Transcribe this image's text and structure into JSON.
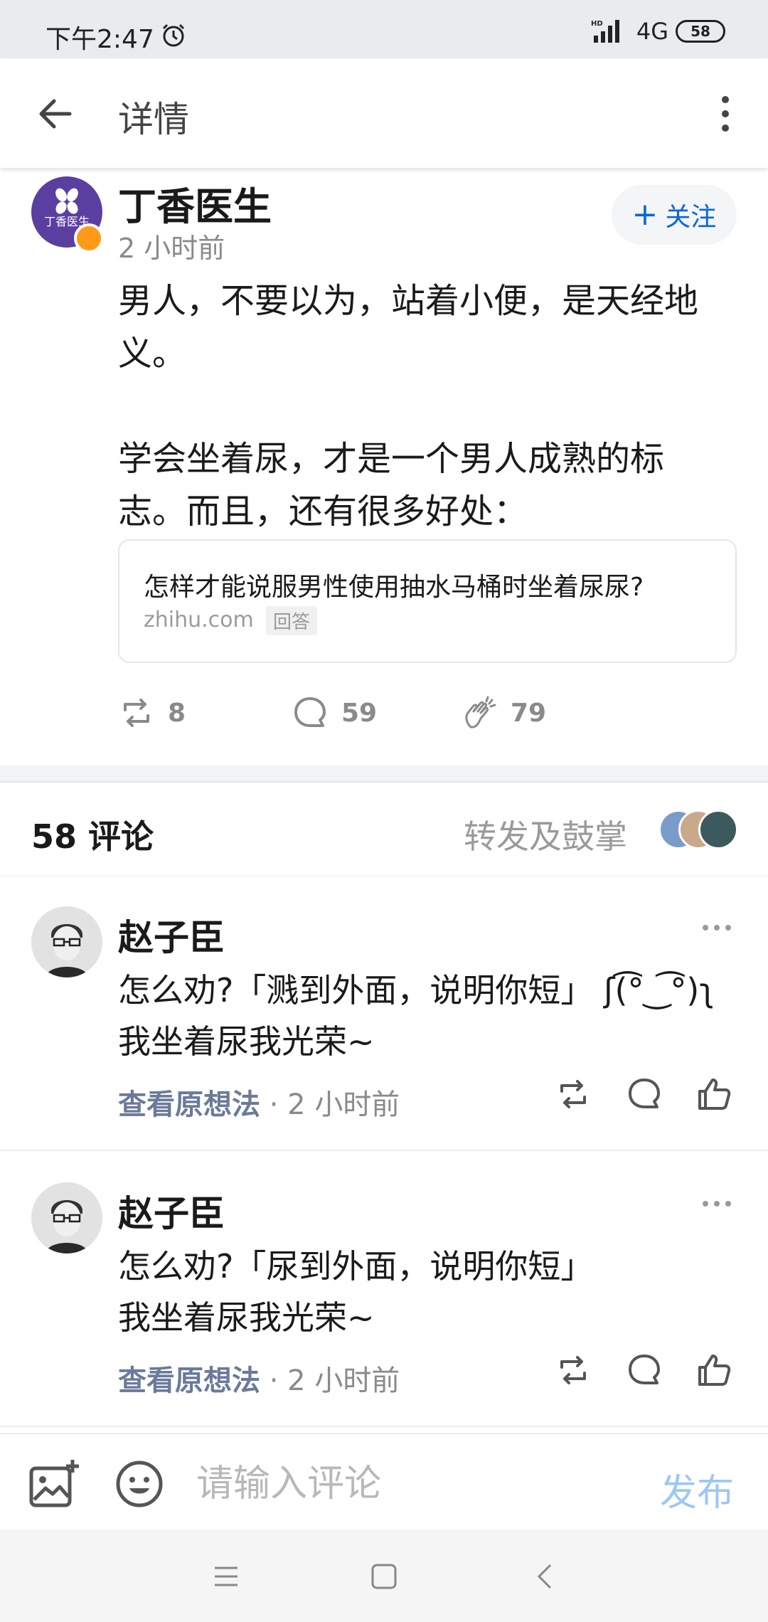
{
  "status_bar": {
    "time": "下午2:47",
    "hd_label": "HD",
    "network": "4G",
    "battery": "58"
  },
  "app_bar": {
    "title": "详情"
  },
  "post": {
    "author": "丁香医生",
    "avatar_text": "丁香医生",
    "time": "2 小时前",
    "follow_label": "关注",
    "paragraphs": [
      "男人，不要以为，站着小便，是天经地义。",
      "",
      "学会坐着尿，才是一个男人成熟的标志。而且，还有很多好处："
    ],
    "link_card": {
      "title": "怎样才能说服男性使用抽水马桶时坐着尿尿?",
      "source": "zhihu.com",
      "tag": "回答"
    },
    "stats": {
      "reposts": "8",
      "comments": "59",
      "claps": "79"
    }
  },
  "comments_section": {
    "count_label": "58 评论",
    "reposts_label": "转发及鼓掌",
    "avatar_colors": [
      "#7a9cc9",
      "#c9a98c",
      "#3c5a5e"
    ],
    "items": [
      {
        "author": "赵子臣",
        "text_line1": "怎么劝?「溅到外面，说明你短」",
        "kaomoji": "ʃ(͡°‿͡°)ʅ",
        "text_line2": "我坐着尿我光荣~",
        "view_original": "查看原想法",
        "time": "· 2 小时前"
      },
      {
        "author": "赵子臣",
        "text_line1": "怎么劝?「尿到外面，说明你短」",
        "kaomoji": "",
        "text_line2": "我坐着尿我光荣~",
        "view_original": "查看原想法",
        "time": "· 2 小时前"
      }
    ]
  },
  "input_bar": {
    "placeholder": "请输入评论",
    "publish_label": "发布"
  },
  "colors": {
    "accent_blue": "#0a66d8",
    "badge_orange": "#ff9a1a",
    "org_purple": "#5b3fa0"
  }
}
